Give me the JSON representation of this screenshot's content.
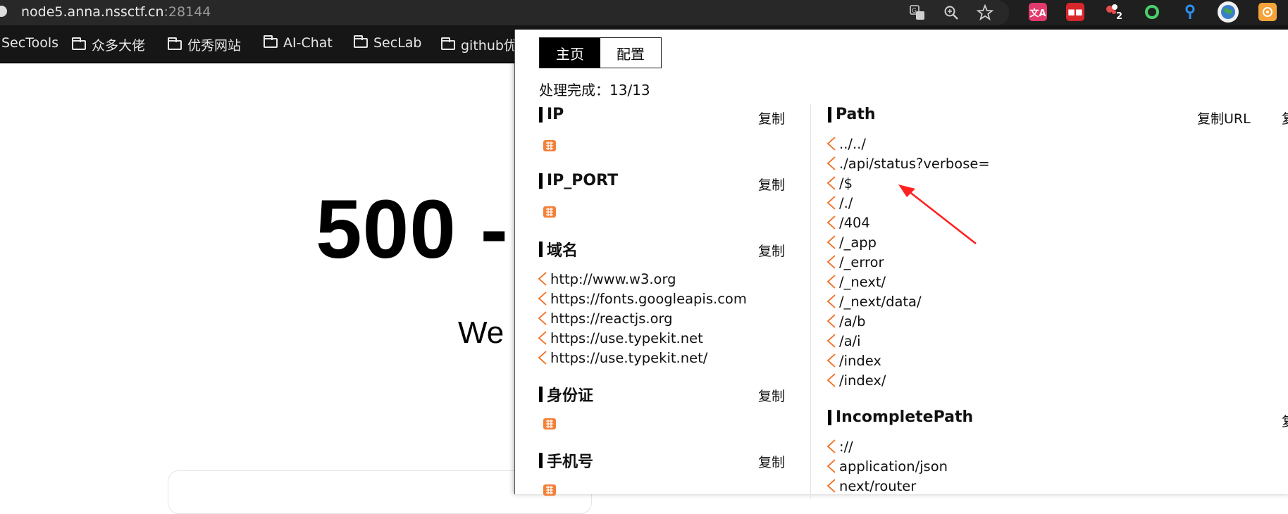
{
  "browser": {
    "url_host": "node5.anna.nssctf.cn",
    "url_port": ":28144",
    "ext_badge": "2"
  },
  "bookmarks": [
    {
      "label": "SecTools",
      "folder": false
    },
    {
      "label": "众多大佬",
      "folder": true
    },
    {
      "label": "优秀网站",
      "folder": true
    },
    {
      "label": "AI-Chat",
      "folder": true
    },
    {
      "label": "SecLab",
      "folder": true
    },
    {
      "label": "github优",
      "folder": true
    }
  ],
  "page": {
    "error_code": "500 -",
    "subtitle": "We"
  },
  "panel": {
    "tabs": [
      {
        "label": "主页"
      },
      {
        "label": "配置"
      }
    ],
    "status": "处理完成：13/13",
    "copy_label": "复制",
    "copy_url_label": "复制URL",
    "copy_truncated": "复",
    "sections_left": [
      {
        "title": "IP",
        "items": []
      },
      {
        "title": "IP_PORT",
        "items": []
      },
      {
        "title": "域名",
        "items": [
          "http://www.w3.org",
          "https://fonts.googleapis.com",
          "https://reactjs.org",
          "https://use.typekit.net",
          "https://use.typekit.net/"
        ]
      },
      {
        "title": "身份证",
        "items": []
      },
      {
        "title": "手机号",
        "items": []
      }
    ],
    "path": {
      "title": "Path",
      "items": [
        "../../",
        "./api/status?verbose=",
        "/$",
        "/./",
        "/404",
        "/_app",
        "/_error",
        "/_next/",
        "/_next/data/",
        "/a/b",
        "/a/i",
        "/index",
        "/index/"
      ]
    },
    "incomplete": {
      "title": "IncompletePath",
      "items": [
        "://",
        "application/json",
        "next/router"
      ]
    },
    "accent_color": "#f26b1d"
  }
}
